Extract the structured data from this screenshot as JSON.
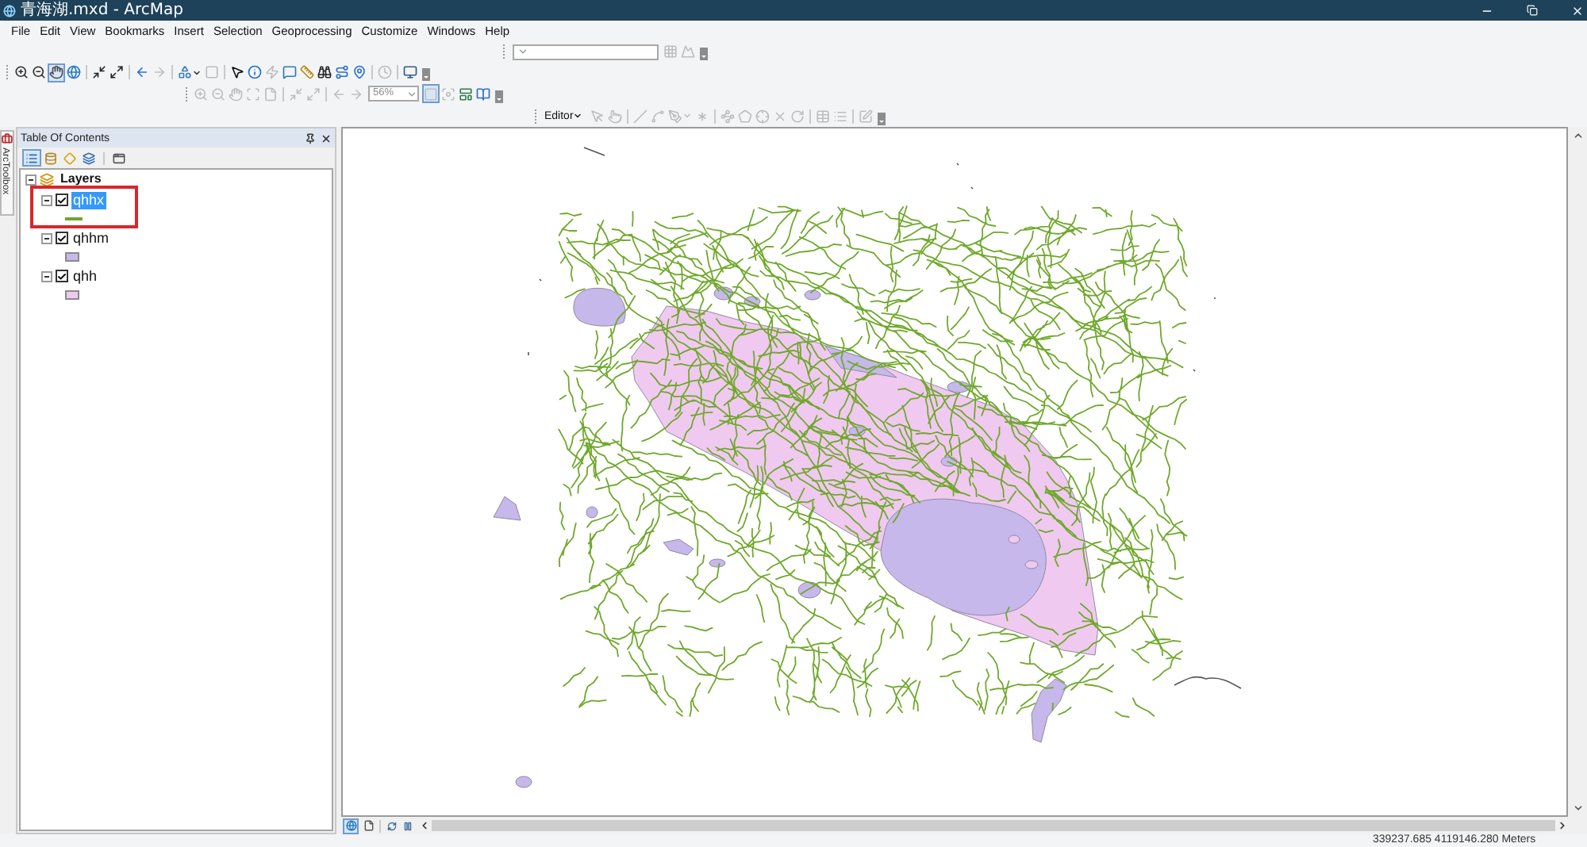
{
  "window": {
    "title": "青海湖.mxd - ArcMap"
  },
  "menu": [
    "File",
    "Edit",
    "View",
    "Bookmarks",
    "Insert",
    "Selection",
    "Geoprocessing",
    "Customize",
    "Windows",
    "Help"
  ],
  "toolbars": [
    {
      "items": [
        {
          "kind": "combo",
          "disabled": true
        },
        {
          "kind": "button",
          "selected": false,
          "disabled": true
        },
        {
          "kind": "button",
          "selected": false,
          "disabled": true
        }
      ]
    },
    {
      "items": [
        {
          "kind": "button",
          "selected": false,
          "disabled": false
        },
        {
          "kind": "button",
          "selected": false,
          "disabled": false
        },
        {
          "kind": "button",
          "selected": true,
          "disabled": false
        },
        {
          "kind": "button",
          "selected": false,
          "disabled": false
        },
        {
          "kind": "button",
          "selected": false,
          "disabled": false
        },
        {
          "kind": "button",
          "selected": false,
          "disabled": false
        },
        {
          "kind": "button",
          "selected": false,
          "disabled": false
        },
        {
          "kind": "button",
          "selected": false,
          "disabled": true
        },
        {
          "kind": "button",
          "selected": false,
          "disabled": false
        },
        {
          "kind": "button",
          "selected": false,
          "disabled": true
        },
        {
          "kind": "button",
          "selected": false,
          "disabled": false
        },
        {
          "kind": "button",
          "selected": false,
          "disabled": false
        },
        {
          "kind": "button",
          "selected": false,
          "disabled": true
        },
        {
          "kind": "button",
          "selected": false,
          "disabled": false
        },
        {
          "kind": "button",
          "selected": false,
          "disabled": false
        },
        {
          "kind": "button",
          "selected": false,
          "disabled": false
        },
        {
          "kind": "button",
          "selected": false,
          "disabled": false
        },
        {
          "kind": "button",
          "selected": false,
          "disabled": false
        },
        {
          "kind": "button",
          "selected": false,
          "disabled": true
        },
        {
          "kind": "button",
          "selected": false,
          "disabled": false
        }
      ]
    },
    {
      "items": [
        {
          "kind": "button",
          "selected": false,
          "disabled": true
        },
        {
          "kind": "button",
          "selected": false,
          "disabled": true
        },
        {
          "kind": "button",
          "selected": false,
          "disabled": true
        },
        {
          "kind": "button",
          "selected": false,
          "disabled": true
        },
        {
          "kind": "button",
          "selected": false,
          "disabled": true
        },
        {
          "kind": "button",
          "selected": false,
          "disabled": true
        },
        {
          "kind": "button",
          "selected": false,
          "disabled": true
        },
        {
          "kind": "button",
          "selected": false,
          "disabled": true
        },
        {
          "kind": "button",
          "selected": false,
          "disabled": true
        },
        {
          "kind": "combo",
          "value": "56%",
          "disabled": true
        },
        {
          "kind": "button",
          "selected": true,
          "disabled": true
        },
        {
          "kind": "button",
          "selected": false,
          "disabled": true
        },
        {
          "kind": "button",
          "selected": false,
          "disabled": false
        },
        {
          "kind": "button",
          "selected": false,
          "disabled": false
        }
      ]
    },
    {
      "items": [
        {
          "kind": "menu",
          "label": "Editor"
        },
        {
          "kind": "button",
          "selected": false,
          "disabled": true
        },
        {
          "kind": "button",
          "selected": false,
          "disabled": true
        },
        {
          "kind": "button",
          "selected": false,
          "disabled": true
        },
        {
          "kind": "button",
          "selected": false,
          "disabled": true
        },
        {
          "kind": "button",
          "selected": false,
          "disabled": true
        },
        {
          "kind": "button",
          "selected": false,
          "disabled": true
        },
        {
          "kind": "button",
          "selected": false,
          "disabled": true
        },
        {
          "kind": "button",
          "selected": false,
          "disabled": true
        },
        {
          "kind": "button",
          "selected": false,
          "disabled": true
        },
        {
          "kind": "button",
          "selected": false,
          "disabled": true
        },
        {
          "kind": "button",
          "selected": false,
          "disabled": true
        },
        {
          "kind": "button",
          "selected": false,
          "disabled": true
        },
        {
          "kind": "button",
          "selected": false,
          "disabled": true
        },
        {
          "kind": "button",
          "selected": false,
          "disabled": true
        }
      ]
    }
  ],
  "arctoolbox_tab": {
    "label": "ArcToolbox"
  },
  "toc": {
    "title": "Table Of Contents",
    "view_buttons": [
      {
        "selected": true
      },
      {
        "selected": false
      },
      {
        "selected": false
      },
      {
        "selected": false
      }
    ],
    "root": {
      "label": "Layers",
      "expanded": true,
      "children": [
        {
          "label": "qhhx",
          "checked": true,
          "selected": true,
          "expanded": true,
          "highlighted": true,
          "symbol": {
            "kind": "line",
            "color": "#6fa82b"
          }
        },
        {
          "label": "qhhm",
          "checked": true,
          "selected": false,
          "expanded": true,
          "highlighted": false,
          "symbol": {
            "kind": "fill",
            "color": "#c6b8ea"
          }
        },
        {
          "label": "qhh",
          "checked": true,
          "selected": false,
          "expanded": true,
          "highlighted": false,
          "symbol": {
            "kind": "fill",
            "color": "#f0c9f0"
          }
        }
      ]
    }
  },
  "map_view_buttons": [
    {
      "selected": true
    },
    {
      "selected": false
    }
  ],
  "status_bar": {
    "coordinates": "339237.685 4119146.280 Meters"
  }
}
